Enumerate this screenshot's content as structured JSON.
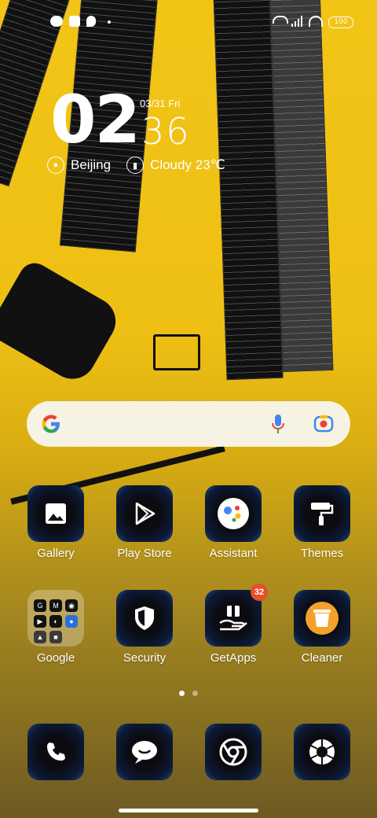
{
  "status_bar": {
    "battery": "100"
  },
  "clock": {
    "hours": "02",
    "minutes": "36",
    "date": "03/31 Fri"
  },
  "weather": {
    "location": "Beijing",
    "condition": "Cloudy 23℃"
  },
  "search": {
    "google_icon": "google-g-icon",
    "mic_icon": "mic-icon",
    "lens_icon": "lens-icon"
  },
  "apps_row1": [
    {
      "label": "Gallery",
      "icon": "gallery-icon"
    },
    {
      "label": "Play Store",
      "icon": "play-store-icon"
    },
    {
      "label": "Assistant",
      "icon": "assistant-icon"
    },
    {
      "label": "Themes",
      "icon": "paint-roller-icon"
    }
  ],
  "apps_row2": [
    {
      "label": "Google",
      "icon": "folder-icon"
    },
    {
      "label": "Security",
      "icon": "shield-icon"
    },
    {
      "label": "GetApps",
      "icon": "getapps-icon",
      "badge": "32"
    },
    {
      "label": "Cleaner",
      "icon": "trash-icon"
    }
  ],
  "folder_letters": [
    "G",
    "M"
  ],
  "dock": [
    {
      "icon": "phone-icon"
    },
    {
      "icon": "messages-icon"
    },
    {
      "icon": "chrome-icon"
    },
    {
      "icon": "camera-icon"
    }
  ],
  "page_indicator": {
    "pages": 2,
    "current": 1
  }
}
